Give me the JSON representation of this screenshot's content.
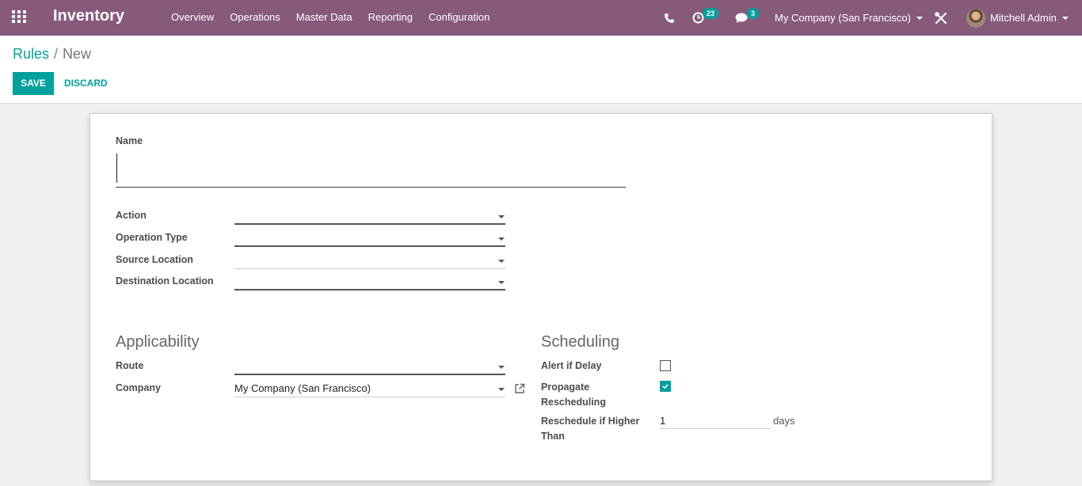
{
  "navbar": {
    "brand": "Inventory",
    "menu": [
      "Overview",
      "Operations",
      "Master Data",
      "Reporting",
      "Configuration"
    ],
    "activity_count": "23",
    "message_count": "3",
    "company": "My Company (San Francisco)",
    "user": "Mitchell Admin"
  },
  "breadcrumb": {
    "parent": "Rules",
    "separator": "/",
    "current": "New"
  },
  "buttons": {
    "save": "SAVE",
    "discard": "DISCARD"
  },
  "form": {
    "name_label": "Name",
    "name_value": "",
    "action_label": "Action",
    "operation_type_label": "Operation Type",
    "source_location_label": "Source Location",
    "destination_location_label": "Destination Location",
    "applicability_title": "Applicability",
    "route_label": "Route",
    "company_label": "Company",
    "company_value": "My Company (San Francisco)",
    "scheduling_title": "Scheduling",
    "alert_if_delay_label": "Alert if Delay",
    "alert_if_delay_checked": false,
    "propagate_label_line1": "Propagate",
    "propagate_label_line2": "Rescheduling",
    "propagate_checked": true,
    "reschedule_label_line1": "Reschedule if Higher",
    "reschedule_label_line2": "Than",
    "reschedule_value": "1",
    "reschedule_unit": "days"
  },
  "colors": {
    "navbar": "#875a7b",
    "accent": "#00a09d"
  }
}
